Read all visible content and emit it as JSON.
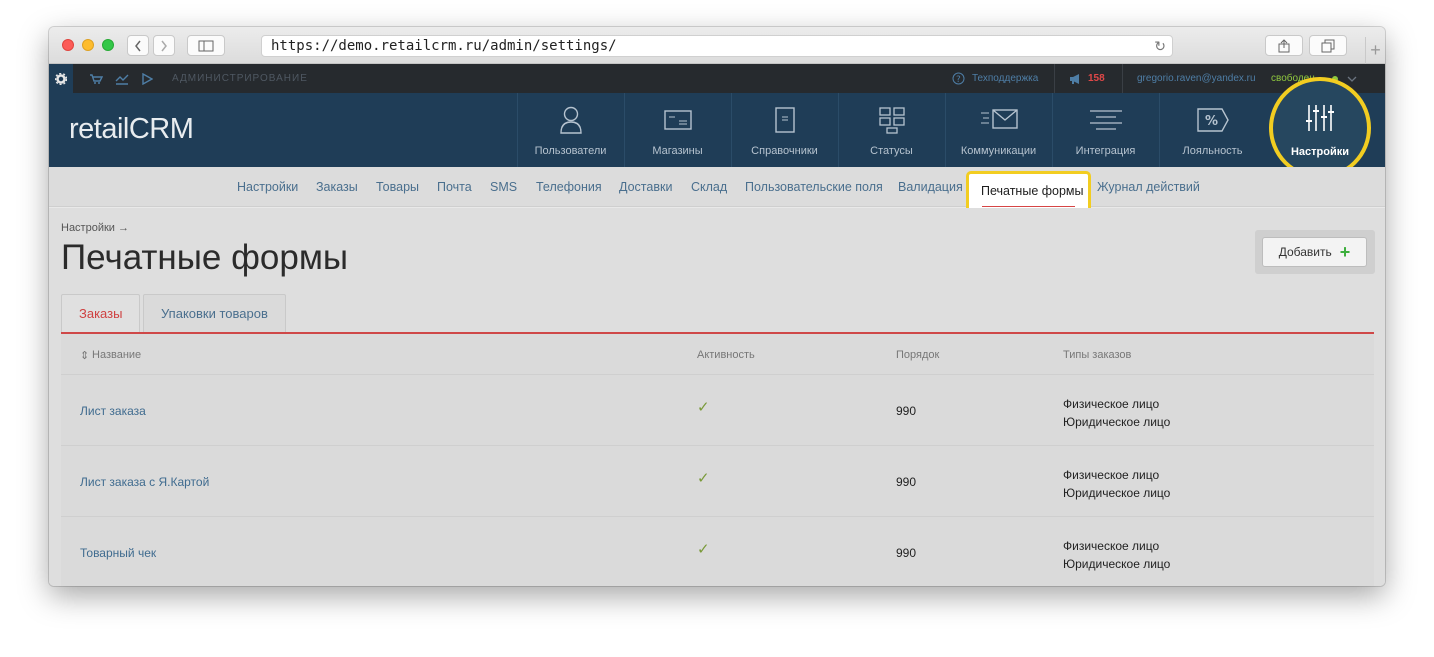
{
  "browser": {
    "url": "https://demo.retailcrm.ru/admin/settings/",
    "back_icon": "chevron-left",
    "forward_icon": "chevron-right"
  },
  "topbar": {
    "section": "АДМИНИСТРИРОВАНИЕ",
    "support": "Техподдержка",
    "notifications": "158",
    "user_email": "gregorio.raven@yandex.ru",
    "user_status": "свободен"
  },
  "header": {
    "logo": "retailCRM",
    "nav": [
      {
        "label": "Пользователи",
        "icon": "user-icon"
      },
      {
        "label": "Магазины",
        "icon": "store-icon"
      },
      {
        "label": "Справочники",
        "icon": "document-icon"
      },
      {
        "label": "Статусы",
        "icon": "status-grid-icon"
      },
      {
        "label": "Коммуникации",
        "icon": "envelope-icon"
      },
      {
        "label": "Интеграция",
        "icon": "integration-icon"
      },
      {
        "label": "Лояльность",
        "icon": "percent-tag-icon"
      }
    ],
    "active_nav": {
      "label": "Настройки",
      "icon": "sliders-icon"
    }
  },
  "subnav": {
    "items": [
      "Настройки",
      "Заказы",
      "Товары",
      "Почта",
      "SMS",
      "Телефония",
      "Доставки",
      "Склад",
      "Пользовательские поля",
      "Валидация"
    ],
    "active": "Печатные формы",
    "after": "Журнал действий"
  },
  "page": {
    "breadcrumb": "Настройки →",
    "title": "Печатные формы",
    "add_button": "Добавить",
    "tabs": [
      "Заказы",
      "Упаковки товаров"
    ]
  },
  "table": {
    "headers": {
      "name": "Название",
      "active": "Активность",
      "order": "Порядок",
      "types": "Типы заказов"
    },
    "rows": [
      {
        "name": "Лист заказа",
        "active": "✓",
        "order": "990",
        "type1": "Физическое лицо",
        "type2": "Юридическое лицо"
      },
      {
        "name": "Лист заказа с Я.Картой",
        "active": "✓",
        "order": "990",
        "type1": "Физическое лицо",
        "type2": "Юридическое лицо"
      },
      {
        "name": "Товарный чек",
        "active": "✓",
        "order": "990",
        "type1": "Физическое лицо",
        "type2": "Юридическое лицо"
      }
    ]
  },
  "colors": {
    "accent_red": "#cf4848",
    "highlight": "#f2cd21",
    "header_bg": "#1f3d57",
    "link": "#4a6f8e"
  }
}
